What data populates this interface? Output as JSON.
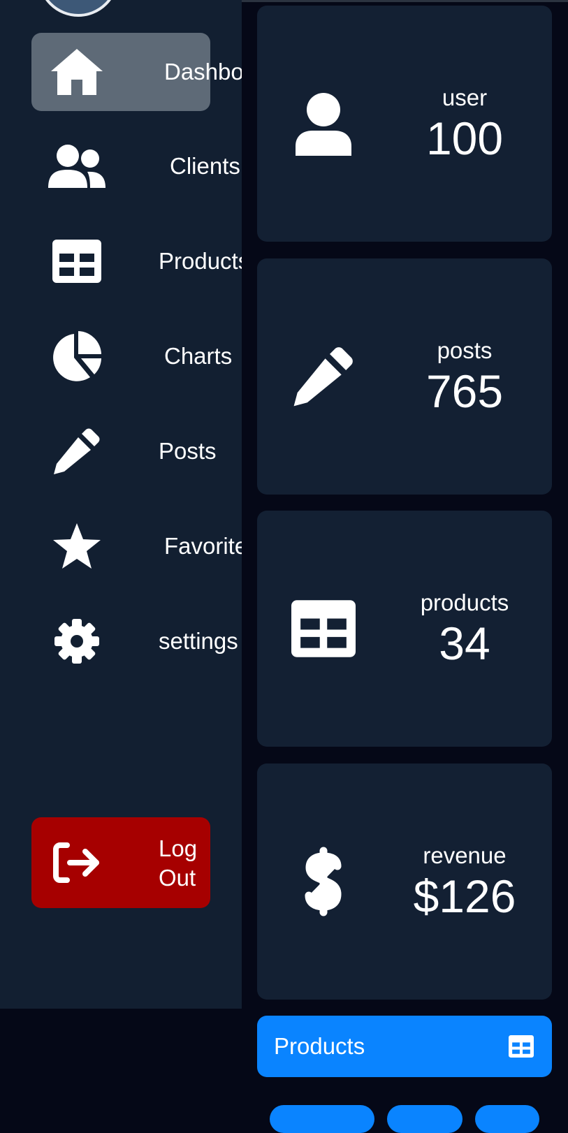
{
  "sidebar": {
    "items": [
      {
        "label": "Dashboard",
        "icon": "home-icon",
        "active": true
      },
      {
        "label": "Clients",
        "icon": "users-icon"
      },
      {
        "label": "Products",
        "icon": "table-icon"
      },
      {
        "label": "Charts",
        "icon": "pie-chart-icon"
      },
      {
        "label": "Posts",
        "icon": "pencil-icon"
      },
      {
        "label": "Favorites",
        "icon": "star-icon"
      },
      {
        "label": "settings",
        "icon": "gear-icon"
      }
    ],
    "logout": {
      "line1": "Log",
      "line2": "Out",
      "icon": "logout-icon"
    }
  },
  "stats": [
    {
      "label": "user",
      "value": "100",
      "icon": "user-icon"
    },
    {
      "label": "posts",
      "value": "765",
      "icon": "pencil-icon"
    },
    {
      "label": "products",
      "value": "34",
      "icon": "table-icon"
    },
    {
      "label": "revenue",
      "value": "$126",
      "icon": "dollar-icon"
    }
  ],
  "products_bar": {
    "label": "Products",
    "icon": "table-icon"
  },
  "colors": {
    "sidebar_bg": "#121f31",
    "page_bg": "#050817",
    "card_bg": "#132033",
    "active_item": "#5e6a77",
    "logout": "#a60000",
    "accent": "#0a84ff"
  }
}
